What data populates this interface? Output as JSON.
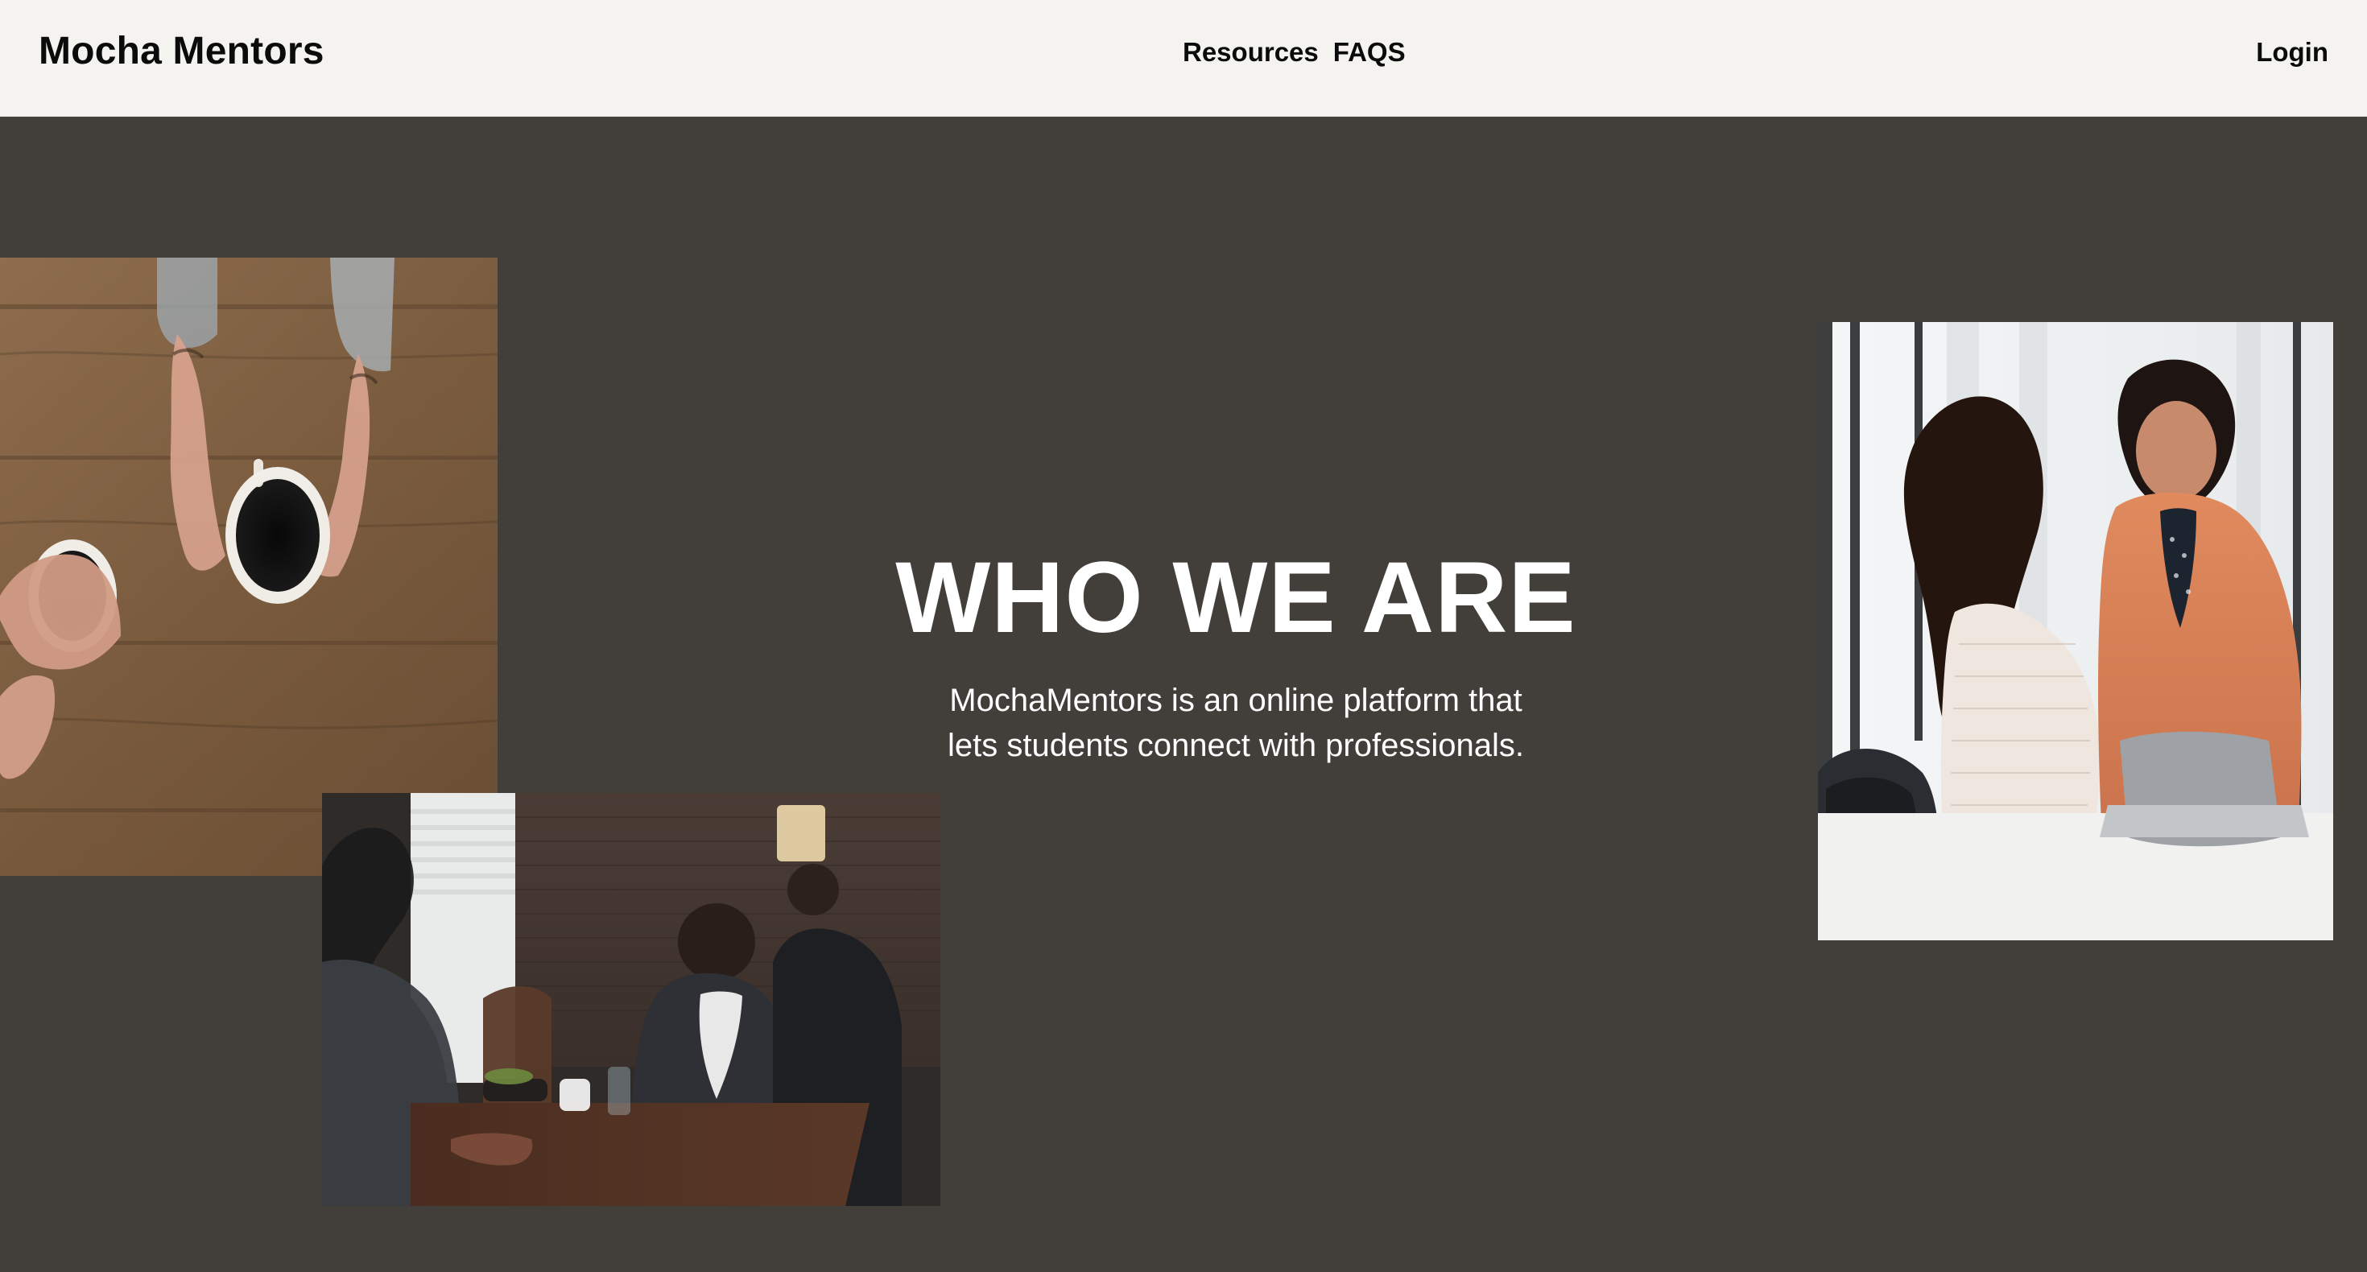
{
  "header": {
    "brand": "Mocha Mentors",
    "nav": [
      "Resources",
      "FAQS"
    ],
    "login": "Login"
  },
  "hero": {
    "title": "WHO WE ARE",
    "subtitle_line1": "MochaMentors is an online platform that",
    "subtitle_line2": "lets students connect with professionals."
  },
  "images": {
    "coffee": {
      "icon": "coffee-cups-photo"
    },
    "restaurant": {
      "icon": "restaurant-meeting-photo"
    },
    "office": {
      "icon": "office-meeting-photo"
    }
  },
  "colors": {
    "header_bg": "#f4f3ef",
    "page_bg": "#423e3a",
    "text_dark": "#0b0b0b",
    "text_light": "#ffffff"
  }
}
